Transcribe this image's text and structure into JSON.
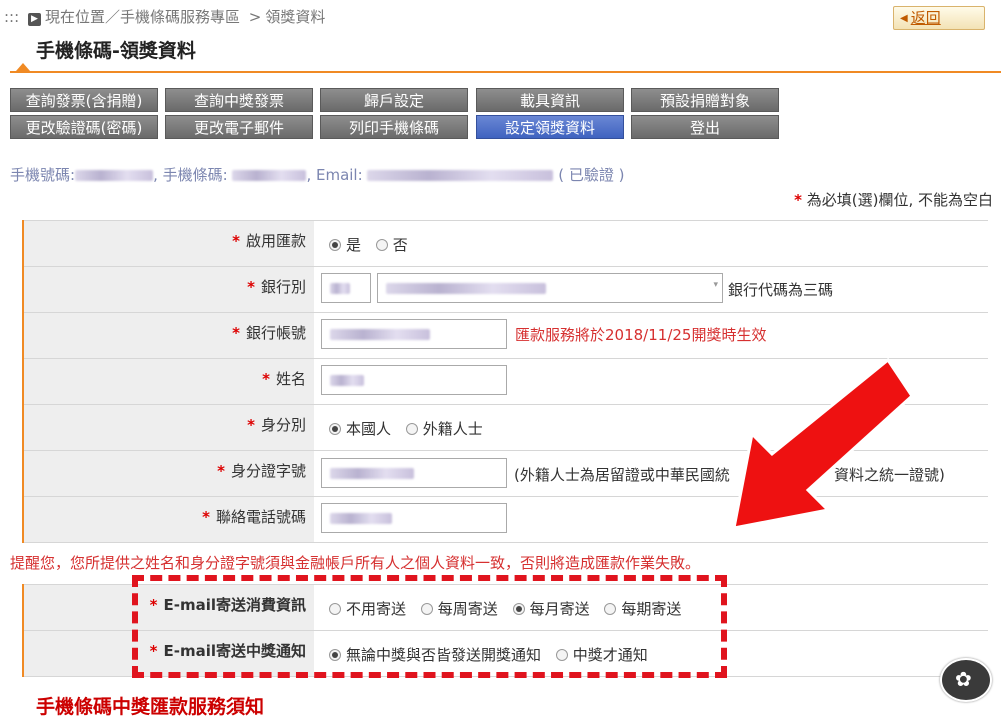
{
  "breadcrumb": {
    "prefix": ":::",
    "current_label": "現在位置",
    "separator": "／",
    "section": "手機條碼服務專區",
    "arrow": ">",
    "page": "領獎資料"
  },
  "back_button": {
    "label": "返回"
  },
  "page_title": "手機條碼-領獎資料",
  "nav_rows": [
    [
      "查詢發票(含捐贈)",
      "查詢中獎發票",
      "歸戶設定",
      "載具資訊",
      "預設捐贈對象"
    ],
    [
      "更改驗證碼(密碼)",
      "更改電子郵件",
      "列印手機條碼",
      "設定領獎資料",
      "登出"
    ]
  ],
  "active_nav": "設定領獎資料",
  "info": {
    "phone_label": "手機號碼:",
    "barcode_label": ", 手機條碼:",
    "email_label": ", Email:",
    "verified": "( 已驗證 )"
  },
  "required_note": "為必填(選)欄位, 不能為空白",
  "form": {
    "enable_remit": {
      "label": "啟用匯款",
      "options": [
        "是",
        "否"
      ],
      "selected": "是"
    },
    "bank": {
      "label": "銀行別",
      "hint": "銀行代碼為三碼"
    },
    "account": {
      "label": "銀行帳號",
      "notice": "匯款服務將於2018/11/25開獎時生效"
    },
    "name": {
      "label": "姓名"
    },
    "identity": {
      "label": "身分別",
      "options": [
        "本國人",
        "外籍人士"
      ],
      "selected": "本國人"
    },
    "id_number": {
      "label": "身分證字號",
      "hint": "(外籍人士為居留證或中華民國統",
      "hint_tail": "資料之統一證號)"
    },
    "phone": {
      "label": "聯絡電話號碼"
    }
  },
  "reminder": "提醒您，您所提供之姓名和身分證字號須與金融帳戶所有人之個人資料一致，否則將造成匯款作業失敗。",
  "email_form": {
    "consumption": {
      "label": "E-mail寄送消費資訊",
      "options": [
        "不用寄送",
        "每周寄送",
        "每月寄送",
        "每期寄送"
      ],
      "selected": "每月寄送"
    },
    "winning": {
      "label": "E-mail寄送中獎通知",
      "options": [
        "無論中獎與否皆發送開獎通知",
        "中獎才通知"
      ],
      "selected": "無論中獎與否皆發送開獎通知"
    }
  },
  "footer_title": "手機條碼中獎匯款服務須知",
  "colors": {
    "accent": "#f08a24",
    "nav_active": "#3f63c0",
    "nav": "#7a7a7a",
    "alert": "#e0141e"
  }
}
